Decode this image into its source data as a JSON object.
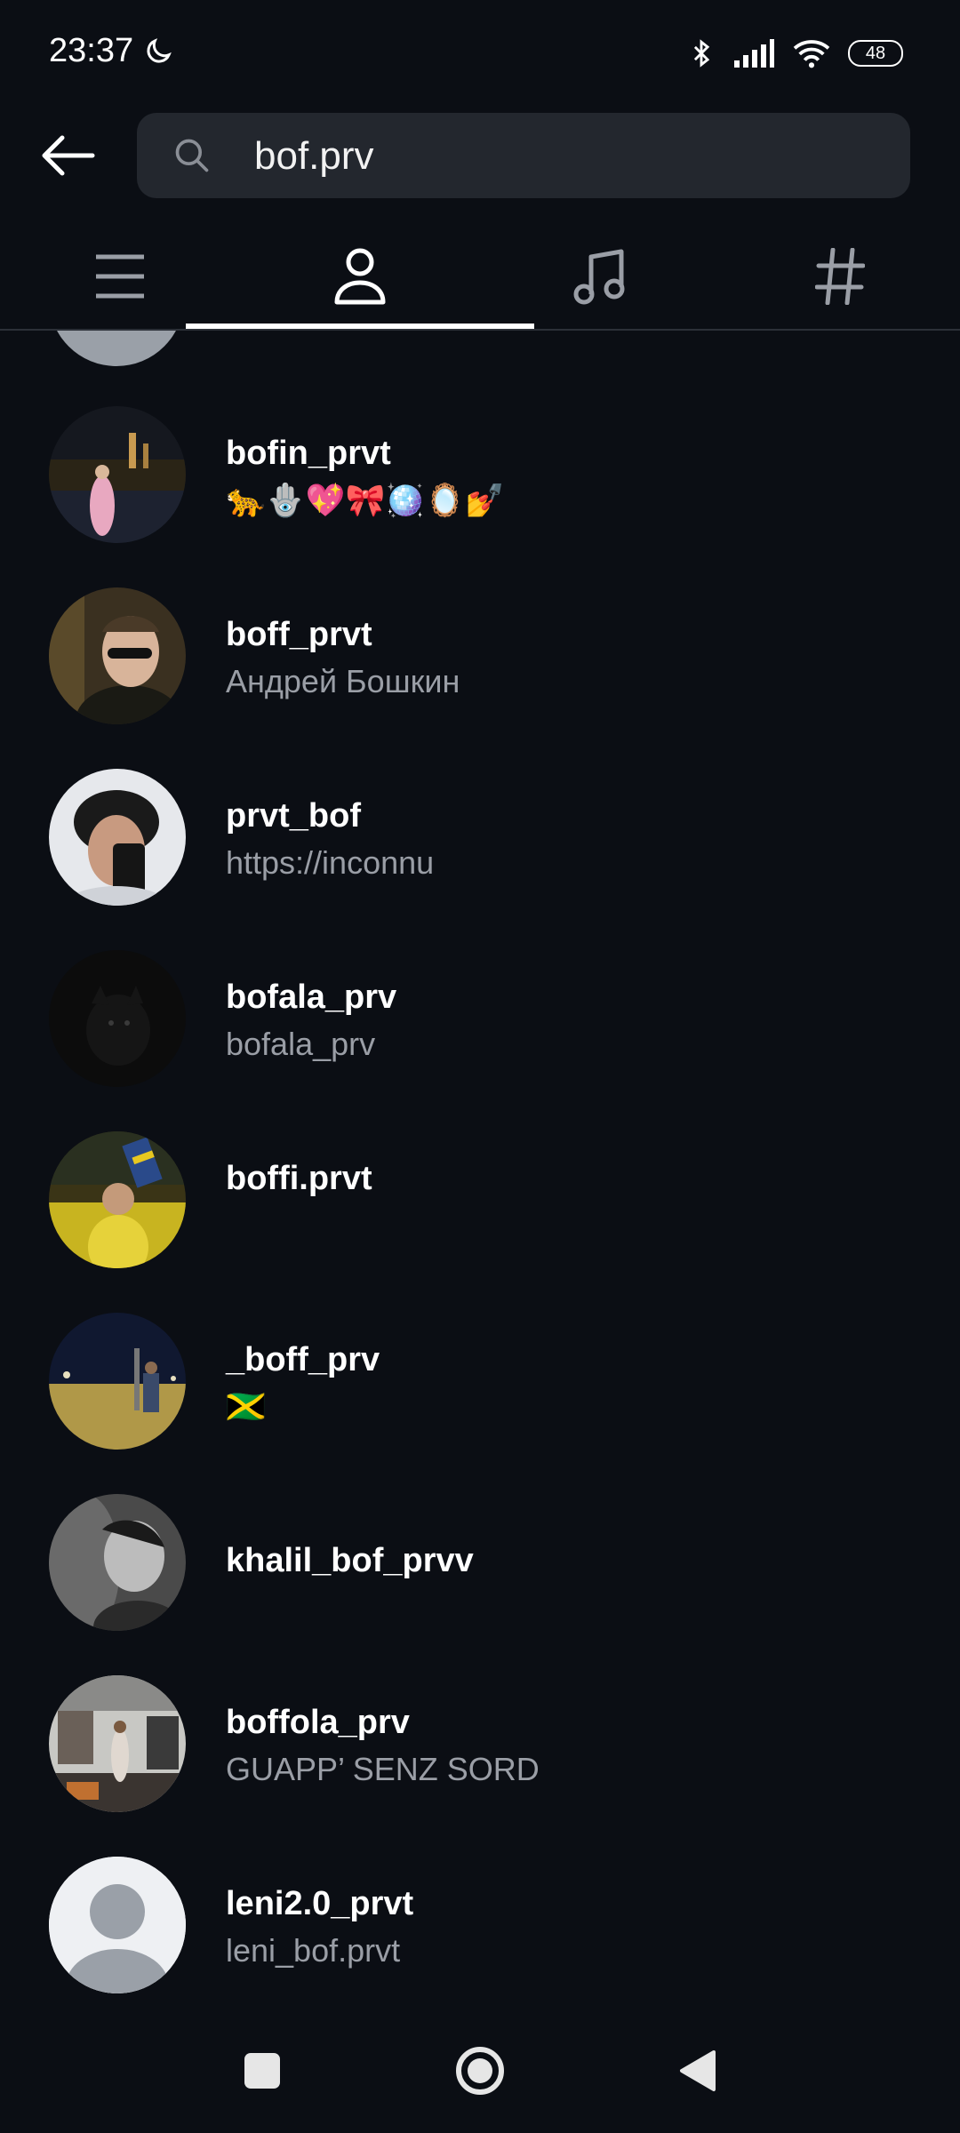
{
  "status_bar": {
    "time": "23:37",
    "battery": "48",
    "icons": [
      "moon-icon",
      "bluetooth-icon",
      "signal-icon",
      "wifi-icon",
      "battery-icon"
    ]
  },
  "search": {
    "value": "bof.prv",
    "icon": "search-icon"
  },
  "tabs": [
    {
      "name": "tab-top",
      "icon": "list-icon"
    },
    {
      "name": "tab-accounts",
      "icon": "person-icon",
      "active": true
    },
    {
      "name": "tab-audio",
      "icon": "music-note-icon"
    },
    {
      "name": "tab-tags",
      "icon": "hashtag-icon"
    }
  ],
  "results": [
    {
      "username": "bofin_prvt",
      "subtitle": "🐆🪬💖🎀🪩🪞💅"
    },
    {
      "username": "boff_prvt",
      "subtitle": "Андрей Бошкин"
    },
    {
      "username": "prvt_bof",
      "subtitle": "https://inconnu"
    },
    {
      "username": "bofala_prv",
      "subtitle": "bofala_prv"
    },
    {
      "username": "boffi.prvt",
      "subtitle": ""
    },
    {
      "username": "_boff_prv",
      "subtitle": "🇯🇲"
    },
    {
      "username": "khalil_bof_prvv",
      "subtitle": ""
    },
    {
      "username": "boffola_prv",
      "subtitle": "GUAPP’ SENZ SORD"
    },
    {
      "username": "leni2.0_prvt",
      "subtitle": "leni_bof.prvt"
    }
  ],
  "colors": {
    "background": "#0b0e14",
    "search_bg": "#23272e",
    "subtitle": "#9a9ea6",
    "active_tab": "#ffffff",
    "inactive_tab": "#9a9ea6"
  }
}
